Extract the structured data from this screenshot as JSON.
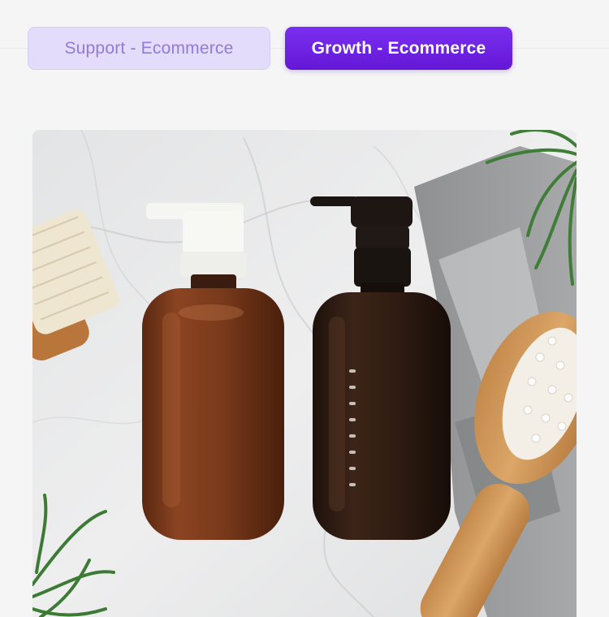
{
  "tabs": [
    {
      "label": "Support - Ecommerce",
      "active": false
    },
    {
      "label": "Growth - Ecommerce",
      "active": true
    }
  ],
  "colors": {
    "page_background": "#f4f5f4",
    "tab_inactive_bg": "#e4dcfb",
    "tab_inactive_text": "#8f7cd9",
    "tab_active_bg": "#6b22e3",
    "tab_active_text": "#ffffff"
  },
  "photo": {
    "subject": "product-photo-amber-pump-bottles",
    "icon": "image-icon"
  }
}
